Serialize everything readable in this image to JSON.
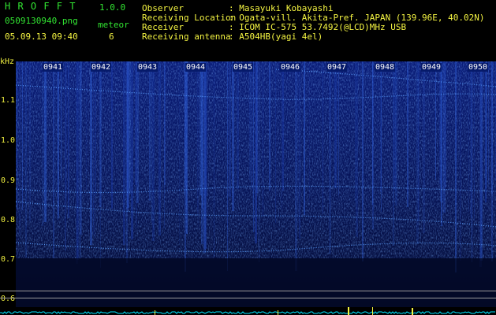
{
  "header": {
    "app_title": "H R O F F T",
    "version": "1.0.0",
    "filename": "0509130940.png",
    "meteor_label": "meteor",
    "datetime": "05.09.13 09:40",
    "meteor_count": "6",
    "info_labels": [
      "Observer",
      "Receiving Location",
      "Receiver",
      "Receiving antenna"
    ],
    "info_values": [
      ": Masayuki Kobayashi",
      ": Ogata-vill. Akita-Pref. JAPAN (139.96E, 40.02N)",
      ": ICOM IC-575 53.7492(@LCD)MHz USB",
      ": A504HB(yagi 4el)"
    ]
  },
  "axis": {
    "unit": "kHz",
    "frequency_ticks": [
      "1.1",
      "1.0",
      "0.9",
      "0.8",
      "0.7",
      "0.6"
    ],
    "time_ticks": [
      "0941",
      "0942",
      "0943",
      "0944",
      "0945",
      "0946",
      "0947",
      "0948",
      "0949",
      "0950"
    ]
  },
  "colors": {
    "header_text": "#32e632",
    "header_values": "#f5f542",
    "spectrogram_bg": "#06103a",
    "signal": "#3c7cff",
    "noise_trace": "#00e5ff"
  }
}
